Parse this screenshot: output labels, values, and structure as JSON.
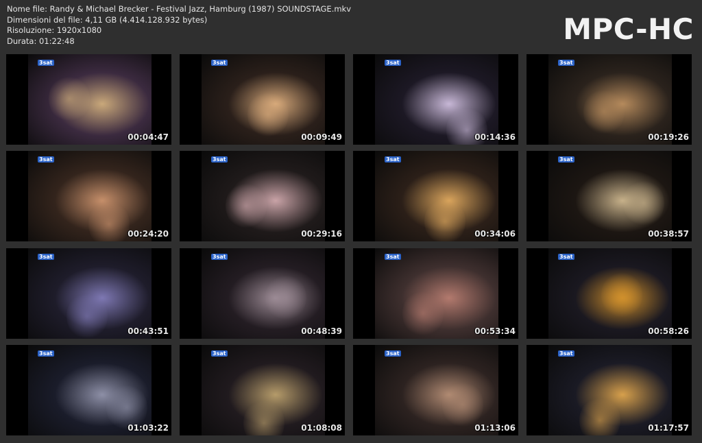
{
  "info": {
    "filename": "Nome file: Randy & Michael Brecker - Festival Jazz, Hamburg (1987) SOUNDSTAGE.mkv",
    "filesize": "Dimensioni del file: 4,11 GB (4.414.128.932 bytes)",
    "resolution": "Risoluzione: 1920x1080",
    "duration": "Durata: 01:22:48"
  },
  "logo": "MPC-HC",
  "thumbnails": [
    {
      "time": "00:04:47",
      "channel": "3sat",
      "tone": "#3b2a3f",
      "accent": "#c9a87a"
    },
    {
      "time": "00:09:49",
      "channel": "3sat",
      "tone": "#2a1f1a",
      "accent": "#d7a97a"
    },
    {
      "time": "00:14:36",
      "channel": "3sat",
      "tone": "#1c1824",
      "accent": "#c7b7d6"
    },
    {
      "time": "00:19:26",
      "channel": "3sat",
      "tone": "#2a221c",
      "accent": "#b58a5c"
    },
    {
      "time": "00:24:20",
      "channel": "3sat",
      "tone": "#33241c",
      "accent": "#c68f6a"
    },
    {
      "time": "00:29:16",
      "channel": "3sat",
      "tone": "#1f1a1a",
      "accent": "#c9a3a7"
    },
    {
      "time": "00:34:06",
      "channel": "3sat",
      "tone": "#2b1f18",
      "accent": "#d9a45c"
    },
    {
      "time": "00:38:57",
      "channel": "3sat",
      "tone": "#1c1612",
      "accent": "#c7b18a"
    },
    {
      "time": "00:43:51",
      "channel": "3sat",
      "tone": "#1e1c2a",
      "accent": "#7e78b3"
    },
    {
      "time": "00:48:39",
      "channel": "3sat",
      "tone": "#231c22",
      "accent": "#9c8b95"
    },
    {
      "time": "00:53:34",
      "channel": "3sat",
      "tone": "#3e2f2e",
      "accent": "#b37a6e"
    },
    {
      "time": "00:58:26",
      "channel": "3sat",
      "tone": "#1a1820",
      "accent": "#d0902c"
    },
    {
      "time": "01:03:22",
      "channel": "3sat",
      "tone": "#1a1c2a",
      "accent": "#8d8fa6"
    },
    {
      "time": "01:08:08",
      "channel": "3sat",
      "tone": "#201a1e",
      "accent": "#b59b6a"
    },
    {
      "time": "01:13:06",
      "channel": "3sat",
      "tone": "#2c2220",
      "accent": "#b08a72"
    },
    {
      "time": "01:17:57",
      "channel": "3sat",
      "tone": "#1a1a24",
      "accent": "#d7a04c"
    }
  ]
}
